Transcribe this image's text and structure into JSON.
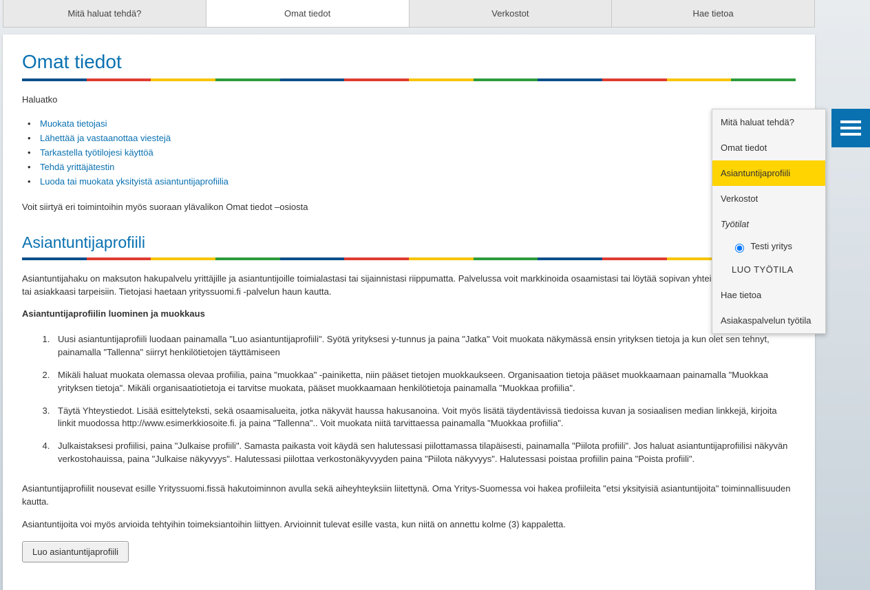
{
  "topnav": {
    "tab1": "Mitä haluat tehdä?",
    "tab2": "Omat tiedot",
    "tab3": "Verkostot",
    "tab4": "Hae tietoa"
  },
  "page": {
    "h1": "Omat tiedot",
    "intro": "Haluatko",
    "links": [
      "Muokata tietojasi",
      "Lähettää ja vastaanottaa viestejä",
      "Tarkastella työtilojesi käyttöä",
      "Tehdä yrittäjätestin",
      "Luoda tai muokata yksityistä asiantuntijaprofiilia"
    ],
    "after_links": "Voit siirtyä eri toimintoihin myös suoraan ylävalikon Omat tiedot –osiosta",
    "h2": "Asiantuntijaprofiili",
    "p1": "Asiantuntijahaku on maksuton hakupalvelu yrittäjille ja asiantuntijoille toimialastasi tai sijainnistasi riippumatta. Palvelussa voit markkinoida osaamistasi tai löytää sopivan yhteistyökumppanin omiin tai asiakkaasi tarpeisiin. Tietojasi haetaan yrityssuomi.fi -palvelun haun kautta.",
    "p2_strong": "Asiantuntijaprofiilin luominen ja muokkaus",
    "ol": [
      "Uusi asiantuntijaprofiili luodaan painamalla \"Luo asiantuntijaprofiili\". Syötä yrityksesi y-tunnus ja paina \"Jatka\" Voit muokata näkymässä ensin yrityksen tietoja ja kun olet sen tehnyt, painamalla \"Tallenna\" siirryt henkilötietojen täyttämiseen",
      "Mikäli haluat muokata olemassa olevaa profiilia, paina \"muokkaa\" -painiketta, niin pääset tietojen muokkaukseen. Organisaation tietoja pääset muokkaamaan painamalla \"Muokkaa yrityksen tietoja\". Mikäli organisaatiotietoja ei tarvitse muokata, pääset muokkaamaan henkilötietoja painamalla \"Muokkaa profiilia\".",
      "Täytä Yhteystiedot. Lisää esittelyteksti, sekä osaamisalueita, jotka näkyvät haussa hakusanoina. Voit myös lisätä täydentävissä tiedoissa kuvan ja sosiaalisen median linkkejä, kirjoita linkit muodossa http://www.esimerkkiosoite.fi. ja paina \"Tallenna\".. Voit muokata niitä tarvittaessa painamalla \"Muokkaa profiilia\".",
      "Julkaistaksesi profiilisi, paina \"Julkaise profiili\". Samasta paikasta voit käydä sen halutessasi piilottamassa tilapäisesti, painamalla \"Piilota profiili\". Jos haluat asiantuntijaprofiilisi näkyvän verkostohauissa, paina \"Julkaise näkyvyys\".  Halutessasi piilottaa verkostonäkyvyyden paina \"Piilota näkyvyys\". Halutessasi poistaa profiilin paina \"Poista profiili\"."
    ],
    "p3": "Asiantuntijaprofiilit nousevat esille Yrityssuomi.fissä hakutoiminnon avulla sekä aiheyhteyksiin liitettynä. Oma Yritys-Suomessa voi hakea profiileita \"etsi yksityisiä asiantuntijoita\" toiminnallisuuden kautta.",
    "p4": "Asiantuntijoita voi myös arvioida tehtyihin toimeksiantoihin liittyen. Arvioinnit tulevat esille vasta, kun niitä on annettu kolme (3) kappaletta.",
    "button": "Luo asiantuntijaprofiili"
  },
  "sidemenu": {
    "i1": "Mitä haluat tehdä?",
    "i2": "Omat tiedot",
    "i3": "Asiantuntijaprofiili",
    "i4": "Verkostot",
    "i5": "Työtilat",
    "radio": "Testi yritys",
    "i6": "LUO TYÖTILA",
    "i7": "Hae tietoa",
    "i8": "Asiakaspalvelun työtila"
  }
}
